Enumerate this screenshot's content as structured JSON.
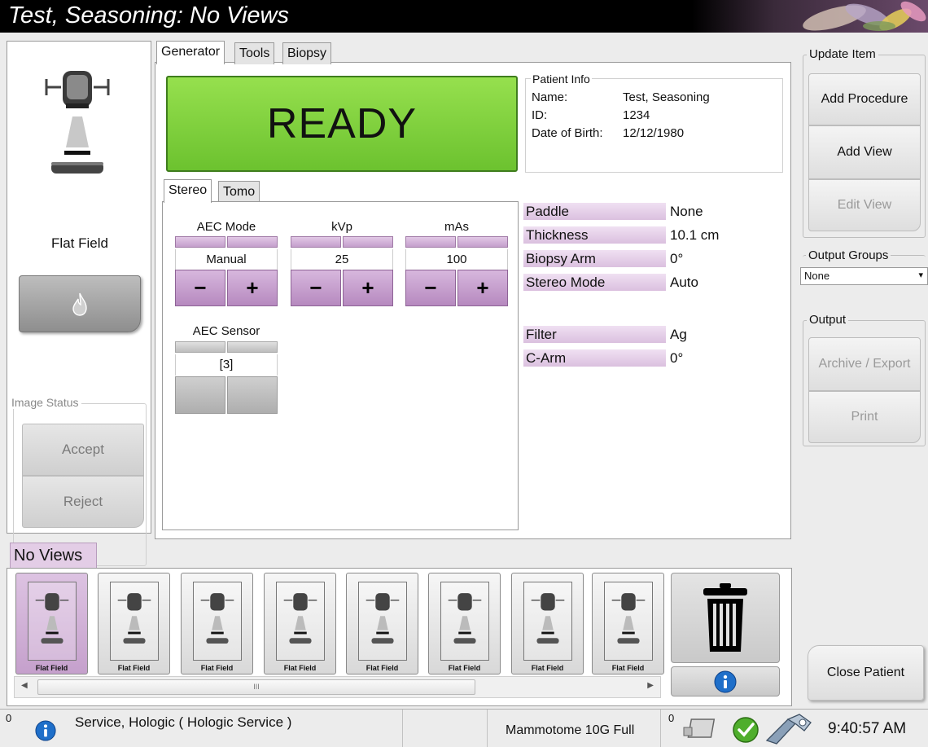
{
  "window": {
    "title": "Test, Seasoning: No Views"
  },
  "left_panel": {
    "view_label": "Flat Field",
    "image_status": {
      "legend": "Image Status",
      "accept_label": "Accept",
      "reject_label": "Reject"
    }
  },
  "tabs": [
    {
      "label": "Generator",
      "active": true
    },
    {
      "label": "Tools",
      "active": false
    },
    {
      "label": "Biopsy",
      "active": false
    }
  ],
  "status": {
    "text": "READY",
    "color": "#7ed03a"
  },
  "patient_info": {
    "legend": "Patient Info",
    "name_label": "Name:",
    "name_value": "Test, Seasoning",
    "id_label": "ID:",
    "id_value": "1234",
    "dob_label": "Date of Birth:",
    "dob_value": "12/12/1980"
  },
  "mode_tabs": [
    {
      "label": "Stereo",
      "active": true
    },
    {
      "label": "Tomo",
      "active": false
    }
  ],
  "controls": {
    "aec_mode": {
      "label": "AEC Mode",
      "value": "Manual"
    },
    "kvp": {
      "label": "kVp",
      "value": "25"
    },
    "mas": {
      "label": "mAs",
      "value": "100"
    },
    "aec_sensor": {
      "label": "AEC Sensor",
      "value": "[3]"
    },
    "minus_symbol": "−",
    "plus_symbol": "+"
  },
  "parameters": [
    {
      "label": "Paddle",
      "value": "None"
    },
    {
      "label": "Thickness",
      "value": "10.1 cm"
    },
    {
      "label": "Biopsy Arm",
      "value": "0°"
    },
    {
      "label": "Stereo Mode",
      "value": "Auto"
    },
    {
      "label": "Filter",
      "value": "Ag"
    },
    {
      "label": "C-Arm",
      "value": "0°"
    }
  ],
  "right_panel": {
    "update_item": {
      "legend": "Update Item",
      "add_procedure": "Add Procedure",
      "add_view": "Add View",
      "edit_view": "Edit View"
    },
    "output_groups": {
      "legend": "Output Groups",
      "selected": "None"
    },
    "output": {
      "legend": "Output",
      "archive_export": "Archive / Export",
      "print": "Print"
    },
    "close_patient": "Close Patient"
  },
  "views": {
    "header": "No Views",
    "thumbnails": [
      {
        "label": "Flat Field",
        "selected": true
      },
      {
        "label": "Flat Field",
        "selected": false
      },
      {
        "label": "Flat Field",
        "selected": false
      },
      {
        "label": "Flat Field",
        "selected": false
      },
      {
        "label": "Flat Field",
        "selected": false
      },
      {
        "label": "Flat Field",
        "selected": false
      },
      {
        "label": "Flat Field",
        "selected": false
      },
      {
        "label": "Flat Field",
        "selected": false
      }
    ],
    "scroll_grip": "III"
  },
  "status_bar": {
    "left_count": "0",
    "user": "Service, Hologic ( Hologic Service )",
    "device": "Mammotome 10G Full",
    "right_count": "0",
    "time": "9:40:57 AM"
  },
  "icons": {
    "info": "info-icon",
    "trash": "trash-icon",
    "checkmark": "check-icon",
    "flame": "flame-icon"
  },
  "colors": {
    "accent_purple": "#c49fcc",
    "ready_green": "#7ed03a",
    "info_blue": "#1f6fc9"
  }
}
